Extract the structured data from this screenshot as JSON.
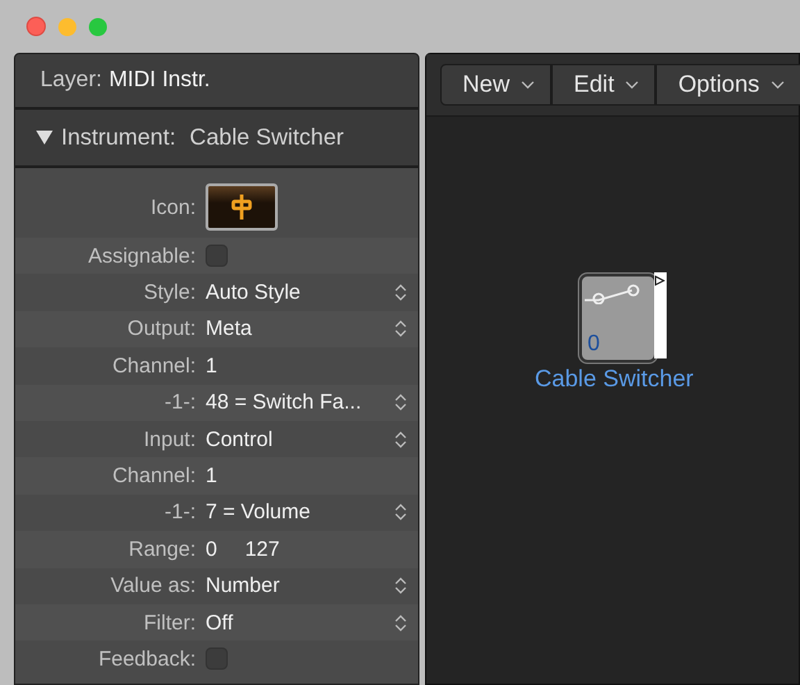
{
  "layer_header": {
    "label": "Layer:",
    "value": "MIDI Instr."
  },
  "instrument_header": {
    "label": "Instrument:",
    "value": "Cable Switcher",
    "expanded": true
  },
  "rows": [
    {
      "kind": "icon",
      "label": "Icon:"
    },
    {
      "kind": "checkbox",
      "label": "Assignable:",
      "checked": false
    },
    {
      "kind": "popup",
      "label": "Style:",
      "value": "Auto Style"
    },
    {
      "kind": "popup",
      "label": "Output:",
      "value": "Meta"
    },
    {
      "kind": "text",
      "label": "Channel:",
      "value": "1"
    },
    {
      "kind": "popup",
      "label": "-1-:",
      "value": "48 = Switch Fa..."
    },
    {
      "kind": "popup",
      "label": "Input:",
      "value": "Control"
    },
    {
      "kind": "text",
      "label": "Channel:",
      "value": "1"
    },
    {
      "kind": "popup",
      "label": "-1-:",
      "value": "7 = Volume"
    },
    {
      "kind": "range",
      "label": "Range:",
      "value": "0",
      "value_2": "127"
    },
    {
      "kind": "popup",
      "label": "Value as:",
      "value": "Number"
    },
    {
      "kind": "popup",
      "label": "Filter:",
      "value": "Off"
    },
    {
      "kind": "checkbox",
      "label": "Feedback:",
      "checked": false
    }
  ],
  "menus": [
    "New",
    "Edit",
    "Options"
  ],
  "canvas_object": {
    "value": "0",
    "name": "Cable Switcher"
  }
}
